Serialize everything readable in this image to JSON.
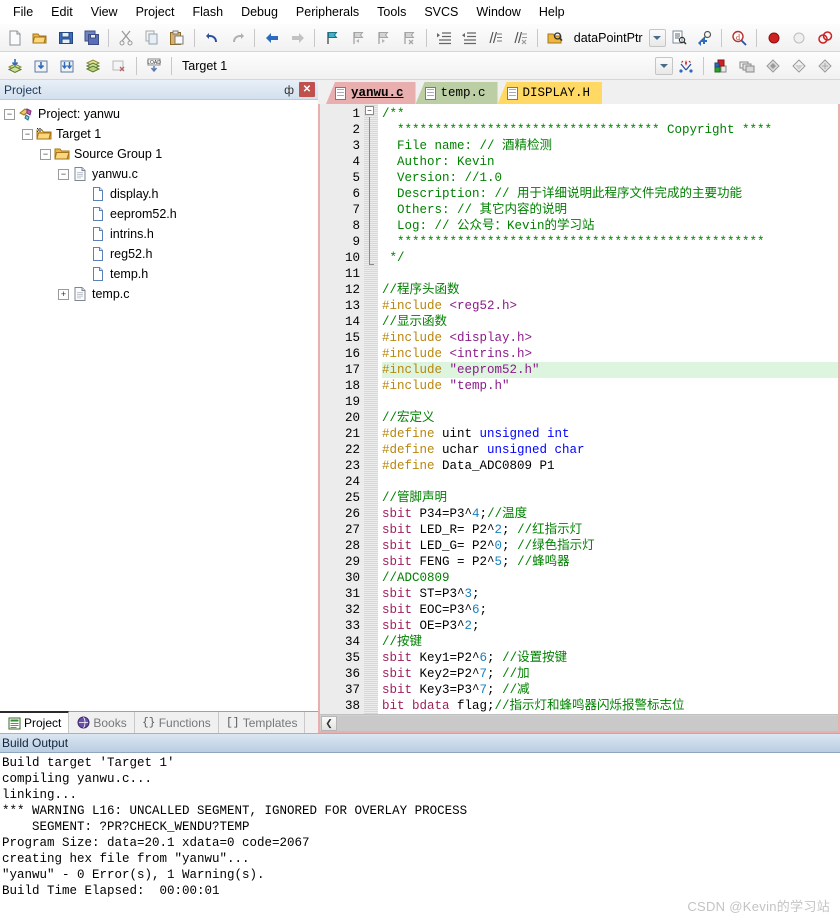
{
  "menubar": {
    "items": [
      {
        "label": "File"
      },
      {
        "label": "Edit"
      },
      {
        "label": "View"
      },
      {
        "label": "Project"
      },
      {
        "label": "Flash"
      },
      {
        "label": "Debug"
      },
      {
        "label": "Peripherals"
      },
      {
        "label": "Tools"
      },
      {
        "label": "SVCS"
      },
      {
        "label": "Window"
      },
      {
        "label": "Help"
      }
    ]
  },
  "toolbar1": {
    "icons": [
      "new-file-icon",
      "open-file-icon",
      "save-icon",
      "save-all-icon",
      "cut-icon",
      "copy-icon",
      "paste-icon",
      "undo-icon",
      "redo-icon",
      "navigate-back-icon",
      "navigate-forward-icon",
      "bookmark-toggle-icon",
      "bookmark-prev-icon",
      "bookmark-next-icon",
      "bookmark-clear-icon",
      "indent-increase-icon",
      "indent-decrease-icon",
      "comment-lines-icon",
      "uncomment-lines-icon",
      "find-in-files-icon"
    ],
    "symbol_combo_value": "dataPointPtr",
    "right_icons": [
      "source-browser-icon",
      "function-nav-icon",
      "find-symbol-icon",
      "insert-breakpoint-icon",
      "disable-breakpoint-icon",
      "kill-all-breakpoints-icon"
    ]
  },
  "toolbar2": {
    "icons": [
      "build-icon",
      "rebuild-icon",
      "rebuild-all-icon",
      "batch-build-icon",
      "stop-build-icon",
      "download-icon"
    ],
    "target_combo_value": "Target 1",
    "right_icons": [
      "target-options-icon",
      "manage-components-icon",
      "multi-project-icon",
      "configure-icon",
      "file-extensions-icon",
      "books-icon"
    ]
  },
  "project_panel": {
    "title": "Project",
    "pin_glyph": "ф",
    "close_label": "✕",
    "tree": [
      {
        "depth": 0,
        "expander": "-",
        "icon": "project-icon",
        "label": "Project: yanwu"
      },
      {
        "depth": 1,
        "expander": "-",
        "icon": "target-icon",
        "label": "Target 1"
      },
      {
        "depth": 2,
        "expander": "-",
        "icon": "folder-icon",
        "label": "Source Group 1"
      },
      {
        "depth": 3,
        "expander": "-",
        "icon": "c-source-icon",
        "label": "yanwu.c"
      },
      {
        "depth": 4,
        "expander": "",
        "icon": "header-file-icon",
        "label": "display.h"
      },
      {
        "depth": 4,
        "expander": "",
        "icon": "header-file-icon",
        "label": "eeprom52.h"
      },
      {
        "depth": 4,
        "expander": "",
        "icon": "header-file-icon",
        "label": "intrins.h"
      },
      {
        "depth": 4,
        "expander": "",
        "icon": "header-file-icon",
        "label": "reg52.h"
      },
      {
        "depth": 4,
        "expander": "",
        "icon": "header-file-icon",
        "label": "temp.h"
      },
      {
        "depth": 3,
        "expander": "+",
        "icon": "c-source-icon",
        "label": "temp.c"
      }
    ],
    "tabs": [
      {
        "label": "Project",
        "icon": "project-tab-icon",
        "active": true
      },
      {
        "label": "Books",
        "icon": "books-tab-icon",
        "active": false
      },
      {
        "label": "Functions",
        "icon": "functions-tab-icon",
        "active": false
      },
      {
        "label": "Templates",
        "icon": "templates-tab-icon",
        "active": false
      }
    ]
  },
  "editor": {
    "tabs": [
      {
        "label": "yanwu.c",
        "color": "red",
        "active": true
      },
      {
        "label": "temp.c",
        "color": "green",
        "active": false
      },
      {
        "label": "DISPLAY.H",
        "color": "yellow",
        "active": false
      }
    ],
    "first_line": 1,
    "highlight_line": 17,
    "lines": [
      {
        "n": 1,
        "segs": [
          {
            "t": "/**",
            "c": "c-comment"
          }
        ]
      },
      {
        "n": 2,
        "segs": [
          {
            "t": "  *********************************** Copyright ****",
            "c": "c-comment"
          }
        ]
      },
      {
        "n": 3,
        "segs": [
          {
            "t": "  File name: // 酒精检测",
            "c": "c-comment"
          }
        ]
      },
      {
        "n": 4,
        "segs": [
          {
            "t": "  Author: Kevin",
            "c": "c-comment"
          }
        ]
      },
      {
        "n": 5,
        "segs": [
          {
            "t": "  Version: //1.0",
            "c": "c-comment"
          }
        ]
      },
      {
        "n": 6,
        "segs": [
          {
            "t": "  Description: // 用于详细说明此程序文件完成的主要功能",
            "c": "c-comment"
          }
        ]
      },
      {
        "n": 7,
        "segs": [
          {
            "t": "  Others: // 其它内容的说明",
            "c": "c-comment"
          }
        ]
      },
      {
        "n": 8,
        "segs": [
          {
            "t": "  Log: // 公众号：Kevin的学习站",
            "c": "c-comment"
          }
        ]
      },
      {
        "n": 9,
        "segs": [
          {
            "t": "  *************************************************",
            "c": "c-comment"
          }
        ]
      },
      {
        "n": 10,
        "segs": [
          {
            "t": " */",
            "c": "c-comment"
          }
        ]
      },
      {
        "n": 11,
        "segs": []
      },
      {
        "n": 12,
        "segs": [
          {
            "t": "//程序头函数",
            "c": "c-comment"
          }
        ]
      },
      {
        "n": 13,
        "segs": [
          {
            "t": "#include ",
            "c": "c-pp"
          },
          {
            "t": "<reg52.h>",
            "c": "c-str"
          }
        ]
      },
      {
        "n": 14,
        "segs": [
          {
            "t": "//显示函数",
            "c": "c-comment"
          }
        ]
      },
      {
        "n": 15,
        "segs": [
          {
            "t": "#include ",
            "c": "c-pp"
          },
          {
            "t": "<display.h>",
            "c": "c-str"
          }
        ]
      },
      {
        "n": 16,
        "segs": [
          {
            "t": "#include ",
            "c": "c-pp"
          },
          {
            "t": "<intrins.h>",
            "c": "c-str"
          }
        ]
      },
      {
        "n": 17,
        "segs": [
          {
            "t": "#include ",
            "c": "c-pp"
          },
          {
            "t": "\"eeprom52.h\"",
            "c": "c-str"
          }
        ]
      },
      {
        "n": 18,
        "segs": [
          {
            "t": "#include ",
            "c": "c-pp"
          },
          {
            "t": "\"temp.h\"",
            "c": "c-str"
          }
        ]
      },
      {
        "n": 19,
        "segs": []
      },
      {
        "n": 20,
        "segs": [
          {
            "t": "//宏定义",
            "c": "c-comment"
          }
        ]
      },
      {
        "n": 21,
        "segs": [
          {
            "t": "#define",
            "c": "c-pp"
          },
          {
            "t": " uint ",
            "c": "c-plain"
          },
          {
            "t": "unsigned int",
            "c": "c-kw"
          }
        ]
      },
      {
        "n": 22,
        "segs": [
          {
            "t": "#define",
            "c": "c-pp"
          },
          {
            "t": " uchar ",
            "c": "c-plain"
          },
          {
            "t": "unsigned char",
            "c": "c-kw"
          }
        ]
      },
      {
        "n": 23,
        "segs": [
          {
            "t": "#define",
            "c": "c-pp"
          },
          {
            "t": " Data_ADC0809 P1",
            "c": "c-plain"
          }
        ]
      },
      {
        "n": 24,
        "segs": []
      },
      {
        "n": 25,
        "segs": [
          {
            "t": "//管脚声明",
            "c": "c-comment"
          }
        ]
      },
      {
        "n": 26,
        "segs": [
          {
            "t": "sbit",
            "c": "c-sbit"
          },
          {
            "t": " P34=P3^",
            "c": "c-plain"
          },
          {
            "t": "4",
            "c": "c-num"
          },
          {
            "t": ";",
            "c": "c-plain"
          },
          {
            "t": "//温度",
            "c": "c-comment"
          }
        ]
      },
      {
        "n": 27,
        "segs": [
          {
            "t": "sbit",
            "c": "c-sbit"
          },
          {
            "t": " LED_R= P2^",
            "c": "c-plain"
          },
          {
            "t": "2",
            "c": "c-num"
          },
          {
            "t": "; ",
            "c": "c-plain"
          },
          {
            "t": "//红指示灯",
            "c": "c-comment"
          }
        ]
      },
      {
        "n": 28,
        "segs": [
          {
            "t": "sbit",
            "c": "c-sbit"
          },
          {
            "t": " LED_G= P2^",
            "c": "c-plain"
          },
          {
            "t": "0",
            "c": "c-num"
          },
          {
            "t": "; ",
            "c": "c-plain"
          },
          {
            "t": "//绿色指示灯",
            "c": "c-comment"
          }
        ]
      },
      {
        "n": 29,
        "segs": [
          {
            "t": "sbit",
            "c": "c-sbit"
          },
          {
            "t": " FENG = P2^",
            "c": "c-plain"
          },
          {
            "t": "5",
            "c": "c-num"
          },
          {
            "t": "; ",
            "c": "c-plain"
          },
          {
            "t": "//蜂鸣器",
            "c": "c-comment"
          }
        ]
      },
      {
        "n": 30,
        "segs": [
          {
            "t": "//ADC0809",
            "c": "c-comment"
          }
        ]
      },
      {
        "n": 31,
        "segs": [
          {
            "t": "sbit",
            "c": "c-sbit"
          },
          {
            "t": " ST=P3^",
            "c": "c-plain"
          },
          {
            "t": "3",
            "c": "c-num"
          },
          {
            "t": ";",
            "c": "c-plain"
          }
        ]
      },
      {
        "n": 32,
        "segs": [
          {
            "t": "sbit",
            "c": "c-sbit"
          },
          {
            "t": " EOC=P3^",
            "c": "c-plain"
          },
          {
            "t": "6",
            "c": "c-num"
          },
          {
            "t": ";",
            "c": "c-plain"
          }
        ]
      },
      {
        "n": 33,
        "segs": [
          {
            "t": "sbit",
            "c": "c-sbit"
          },
          {
            "t": " OE=P3^",
            "c": "c-plain"
          },
          {
            "t": "2",
            "c": "c-num"
          },
          {
            "t": ";",
            "c": "c-plain"
          }
        ]
      },
      {
        "n": 34,
        "segs": [
          {
            "t": "//按键",
            "c": "c-comment"
          }
        ]
      },
      {
        "n": 35,
        "segs": [
          {
            "t": "sbit",
            "c": "c-sbit"
          },
          {
            "t": " Key1=P2^",
            "c": "c-plain"
          },
          {
            "t": "6",
            "c": "c-num"
          },
          {
            "t": "; ",
            "c": "c-plain"
          },
          {
            "t": "//设置按键",
            "c": "c-comment"
          }
        ]
      },
      {
        "n": 36,
        "segs": [
          {
            "t": "sbit",
            "c": "c-sbit"
          },
          {
            "t": " Key2=P2^",
            "c": "c-plain"
          },
          {
            "t": "7",
            "c": "c-num"
          },
          {
            "t": "; ",
            "c": "c-plain"
          },
          {
            "t": "//加",
            "c": "c-comment"
          }
        ]
      },
      {
        "n": 37,
        "segs": [
          {
            "t": "sbit",
            "c": "c-sbit"
          },
          {
            "t": " Key3=P3^",
            "c": "c-plain"
          },
          {
            "t": "7",
            "c": "c-num"
          },
          {
            "t": "; ",
            "c": "c-plain"
          },
          {
            "t": "//减",
            "c": "c-comment"
          }
        ]
      },
      {
        "n": 38,
        "segs": [
          {
            "t": "bit bdata",
            "c": "c-sbit"
          },
          {
            "t": " flag;",
            "c": "c-plain"
          },
          {
            "t": "//指示灯和蜂鸣器闪烁报警标志位",
            "c": "c-comment"
          }
        ]
      }
    ]
  },
  "build_output": {
    "title": "Build Output",
    "text": "Build target 'Target 1'\ncompiling yanwu.c...\nlinking...\n*** WARNING L16: UNCALLED SEGMENT, IGNORED FOR OVERLAY PROCESS\n    SEGMENT: ?PR?CHECK_WENDU?TEMP\nProgram Size: data=20.1 xdata=0 code=2067\ncreating hex file from \"yanwu\"...\n\"yanwu\" - 0 Error(s), 1 Warning(s).\nBuild Time Elapsed:  00:00:01"
  },
  "watermark": {
    "text": "CSDN @Kevin的学习站"
  },
  "colors": {
    "tab_active": "#e9aeae",
    "tab_green": "#bccfa4",
    "tab_yellow": "#ffd964",
    "comment": "#008000",
    "preprocessor": "#b8860b",
    "string": "#8b1a8b",
    "keyword": "#0000ff",
    "sbit": "#a0205a",
    "number": "#1a7fbf",
    "current_line": "#ddf5de",
    "panel_header": "#b9cde2"
  }
}
